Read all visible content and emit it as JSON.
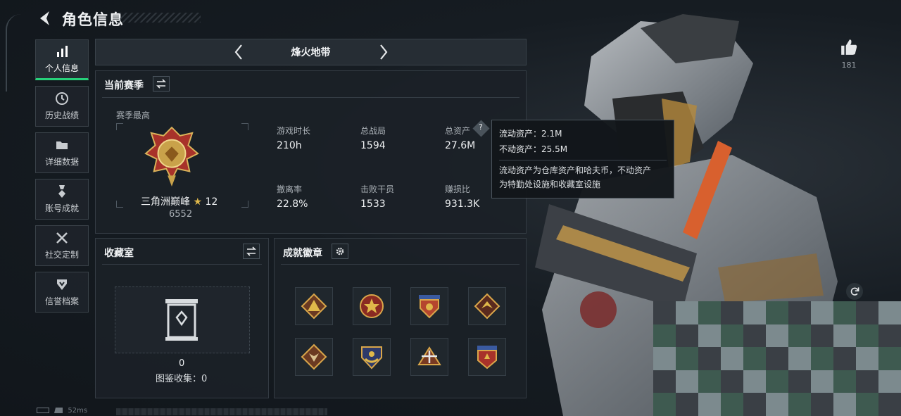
{
  "header": {
    "title": "角色信息"
  },
  "sidebar": {
    "items": [
      {
        "label": "个人信息",
        "icon": "bar-chart-icon",
        "active": true
      },
      {
        "label": "历史战绩",
        "icon": "history-icon"
      },
      {
        "label": "详细数据",
        "icon": "folder-icon"
      },
      {
        "label": "账号成就",
        "icon": "medal-icon"
      },
      {
        "label": "社交定制",
        "icon": "tools-icon"
      },
      {
        "label": "信誉档案",
        "icon": "shield-icon"
      }
    ]
  },
  "mode": {
    "label": "烽火地带"
  },
  "season": {
    "title": "当前赛季",
    "peak_label": "赛季最高",
    "rank_name": "三角洲巅峰",
    "rank_stars": "12",
    "rank_score": "6552",
    "stats": [
      {
        "label": "游戏时长",
        "value": "210h"
      },
      {
        "label": "总战局",
        "value": "1594"
      },
      {
        "label": "总资产",
        "value": "27.6M"
      },
      {
        "label": "撤离率",
        "value": "22.8%"
      },
      {
        "label": "击败干员",
        "value": "1533"
      },
      {
        "label": "赚损比",
        "value": "931.3K"
      }
    ]
  },
  "tooltip": {
    "liquid": "流动资产：2.1M",
    "fixed": "不动资产：25.5M",
    "desc_line1": "流动资产为仓库资产和哈夫币，不动资产",
    "desc_line2": "为特勤处设施和收藏室设施"
  },
  "collection": {
    "title": "收藏室",
    "count": "0",
    "collect_label": "图鉴收集：0"
  },
  "achievements": {
    "title": "成就徽章",
    "badges": [
      "badge-pyramid-icon",
      "badge-star-icon",
      "badge-shield-icon",
      "badge-dragon-icon",
      "badge-wolf-icon",
      "badge-crest-icon",
      "badge-plane-icon",
      "badge-emblem-icon"
    ]
  },
  "likes": {
    "count": "181"
  },
  "status": {
    "ping": "52ms"
  },
  "colors": {
    "accent": "#27d17a",
    "gold": "#c9a24a",
    "panel": "#1b2127"
  }
}
